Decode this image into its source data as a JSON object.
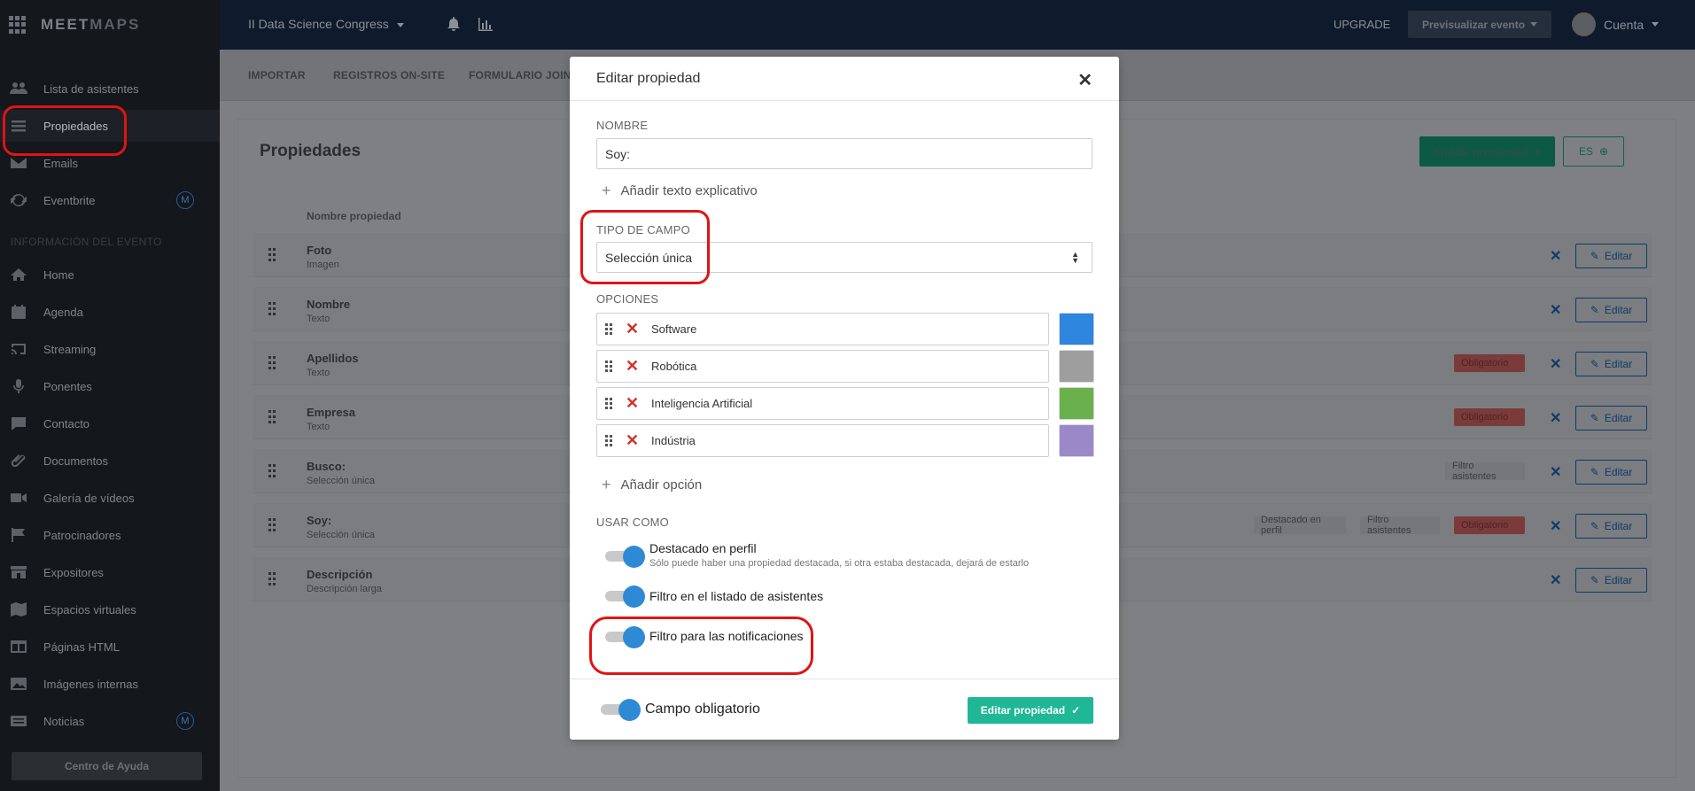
{
  "app": {
    "logo_a": "MEET",
    "logo_b": "MAPS"
  },
  "topbar": {
    "event_name": "II Data Science Congress",
    "upgrade": "UPGRADE",
    "preview": "Previsualizar evento",
    "account": "Cuenta"
  },
  "sidebar": {
    "items": [
      {
        "label": "Lista de asistentes",
        "icon": "users-icon"
      },
      {
        "label": "Propiedades",
        "icon": "list-icon"
      },
      {
        "label": "Emails",
        "icon": "mail-icon"
      },
      {
        "label": "Eventbrite",
        "icon": "refresh-icon",
        "badge": "M"
      }
    ],
    "section_title": "INFORMACIÓN DEL EVENTO",
    "event_items": [
      {
        "label": "Home",
        "icon": "home-icon"
      },
      {
        "label": "Agenda",
        "icon": "calendar-icon"
      },
      {
        "label": "Streaming",
        "icon": "cast-icon"
      },
      {
        "label": "Ponentes",
        "icon": "microphone-icon"
      },
      {
        "label": "Contacto",
        "icon": "chat-icon"
      },
      {
        "label": "Documentos",
        "icon": "paperclip-icon"
      },
      {
        "label": "Galería de vídeos",
        "icon": "video-icon"
      },
      {
        "label": "Patrocinadores",
        "icon": "flag-icon"
      },
      {
        "label": "Expositores",
        "icon": "store-icon"
      },
      {
        "label": "Espacios virtuales",
        "icon": "map-icon"
      },
      {
        "label": "Páginas HTML",
        "icon": "layout-icon"
      },
      {
        "label": "Imágenes internas",
        "icon": "images-icon"
      },
      {
        "label": "Noticias",
        "icon": "news-icon",
        "badge": "M"
      }
    ],
    "help": "Centro de Ayuda"
  },
  "subnav": {
    "tabs": [
      "IMPORTAR",
      "REGISTROS ON-SITE",
      "FORMULARIO JOIN"
    ]
  },
  "main": {
    "title": "Propiedades",
    "add_button": "Añadir propiedad",
    "lang_button": "ES",
    "column_header": "Nombre propiedad",
    "edit_label": "Editar",
    "rows": [
      {
        "name": "Foto",
        "type": "Imagen",
        "tags": []
      },
      {
        "name": "Nombre",
        "type": "Texto",
        "tags": []
      },
      {
        "name": "Apellidos",
        "type": "Texto",
        "tags": [
          "Obligatorio"
        ]
      },
      {
        "name": "Empresa",
        "type": "Texto",
        "tags": [
          "Obligatorio"
        ]
      },
      {
        "name": "Busco:",
        "type": "Selección única",
        "tags": [
          "Filtro asistentes"
        ]
      },
      {
        "name": "Soy:",
        "type": "Selección única",
        "tags": [
          "Destacado en perfil",
          "Filtro asistentes",
          "Obligatorio"
        ]
      },
      {
        "name": "Descripción",
        "type": "Descripción larga",
        "tags": []
      }
    ]
  },
  "modal": {
    "title": "Editar propiedad",
    "name_label": "NOMBRE",
    "name_value": "Soy:",
    "add_explanation": "Añadir texto explicativo",
    "field_type_label": "TIPO DE CAMPO",
    "field_type_value": "Selección única",
    "options_label": "OPCIONES",
    "options": [
      {
        "label": "Software",
        "color": "#2e86de"
      },
      {
        "label": "Robótica",
        "color": "#9e9e9e"
      },
      {
        "label": "Inteligencia Artificial",
        "color": "#6ab04c"
      },
      {
        "label": "Indústria",
        "color": "#9b88c9"
      }
    ],
    "add_option": "Añadir opción",
    "use_as_label": "USAR COMO",
    "toggles": [
      {
        "label": "Destacado en perfil",
        "sub": "Sólo puede haber una propiedad destacada, si otra estaba destacada, dejará de estarlo",
        "on": true
      },
      {
        "label": "Filtro en el listado de asistentes",
        "on": true
      },
      {
        "label": "Filtro para las notificaciones",
        "on": true
      }
    ],
    "required_label": "Campo obligatorio",
    "submit": "Editar propiedad"
  },
  "colors": {
    "accent": "#1fb796",
    "toggle": "#2f8ad6",
    "annotation": "#e01414",
    "delete": "#d0312d"
  }
}
